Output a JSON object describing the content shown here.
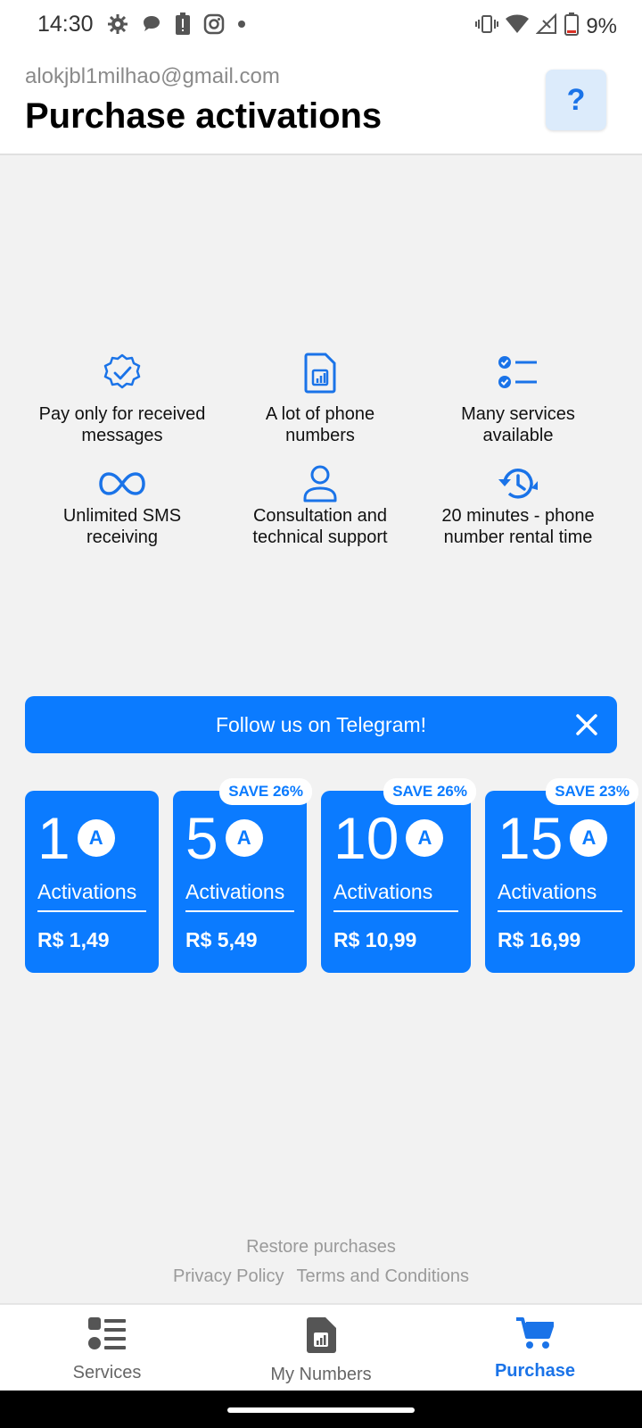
{
  "status_bar": {
    "time": "14:30",
    "battery": "9%",
    "icons_left": [
      "gear-icon",
      "chat-bubble-icon",
      "battery-alert-icon",
      "instagram-icon",
      "dot-icon"
    ],
    "icons_right": [
      "vibrate-icon",
      "wifi-icon",
      "signal-icon",
      "battery-icon"
    ]
  },
  "header": {
    "email": "alokjbl1milhao@gmail.com",
    "title": "Purchase activations",
    "help_label": "?"
  },
  "features": [
    {
      "icon": "verified-badge-icon",
      "text": "Pay only for received\nmessages"
    },
    {
      "icon": "sim-card-icon",
      "text": "A lot of phone\nnumbers"
    },
    {
      "icon": "checklist-icon",
      "text": "Many services\navailable"
    },
    {
      "icon": "infinity-icon",
      "text": "Unlimited SMS\nreceiving"
    },
    {
      "icon": "person-icon",
      "text": "Consultation and\ntechnical support"
    },
    {
      "icon": "history-clock-icon",
      "text": "20 minutes - phone\nnumber rental time"
    }
  ],
  "telegram": {
    "text": "Follow us on Telegram!"
  },
  "plans": [
    {
      "count": "1",
      "badge_letter": "A",
      "label": "Activations",
      "price": "R$ 1,49",
      "save": ""
    },
    {
      "count": "5",
      "badge_letter": "A",
      "label": "Activations",
      "price": "R$ 5,49",
      "save": "SAVE 26%"
    },
    {
      "count": "10",
      "badge_letter": "A",
      "label": "Activations",
      "price": "R$ 10,99",
      "save": "SAVE 26%"
    },
    {
      "count": "15",
      "badge_letter": "A",
      "label": "Activations",
      "price": "R$ 16,99",
      "save": "SAVE 23%"
    }
  ],
  "footer": {
    "restore": "Restore purchases",
    "privacy": "Privacy Policy",
    "terms": "Terms and Conditions"
  },
  "nav": {
    "items": [
      {
        "label": "Services",
        "icon": "services-list-icon",
        "active": false
      },
      {
        "label": "My Numbers",
        "icon": "sim-card-icon",
        "active": false
      },
      {
        "label": "Purchase",
        "icon": "cart-icon",
        "active": true
      }
    ]
  },
  "colors": {
    "accent": "#0b7bff",
    "link_blue": "#1a73e8",
    "background": "#f2f2f2"
  }
}
